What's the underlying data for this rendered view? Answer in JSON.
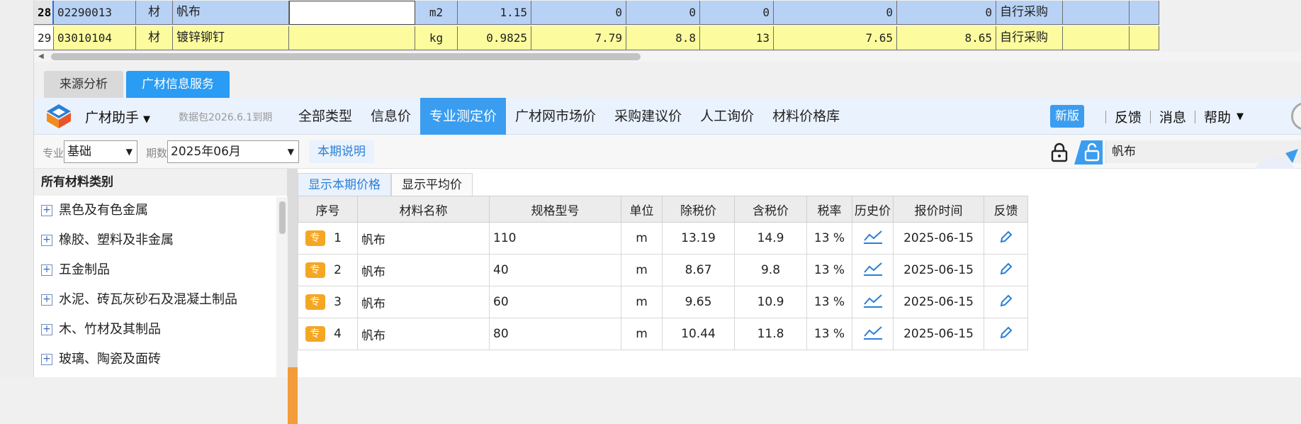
{
  "grid": {
    "rows": [
      {
        "idx": "28",
        "code": "02290013",
        "type": "材",
        "name": "帆布",
        "spec": "",
        "unit": "m2",
        "qty": "1.15",
        "v1": "0",
        "v2": "0",
        "v3": "0",
        "v4": "0",
        "v5": "0",
        "supply": "自行采购"
      },
      {
        "idx": "29",
        "code": "03010104",
        "type": "材",
        "name": "镀锌铆钉",
        "spec": "",
        "unit": "kg",
        "qty": "0.9825",
        "v1": "7.79",
        "v2": "8.8",
        "v3": "13",
        "v4": "7.65",
        "v5": "8.65",
        "supply": "自行采购"
      }
    ]
  },
  "lower_tabs": [
    {
      "label": "来源分析",
      "active": false
    },
    {
      "label": "广材信息服务",
      "active": true
    }
  ],
  "toolbar": {
    "assistant_label": "广材助手",
    "data_package": "数据包2026.6.1到期",
    "nav": [
      {
        "label": "全部类型",
        "active": false
      },
      {
        "label": "信息价",
        "active": false
      },
      {
        "label": "专业测定价",
        "active": true
      },
      {
        "label": "广材网市场价",
        "active": false
      },
      {
        "label": "采购建议价",
        "active": false
      },
      {
        "label": "人工询价",
        "active": false
      },
      {
        "label": "材料价格库",
        "active": false
      }
    ],
    "new_version": "新版",
    "feedback": "反馈",
    "messages": "消息",
    "help": "帮助"
  },
  "filters": {
    "specialty_label": "专业",
    "specialty_value": "基础",
    "period_label": "期数",
    "period_value": "2025年06月",
    "period_note": "本期说明",
    "search_value": "帆布"
  },
  "sidebar": {
    "title": "所有材料类别",
    "items": [
      "黑色及有色金属",
      "橡胶、塑料及非金属",
      "五金制品",
      "水泥、砖瓦灰砂石及混凝土制品",
      "木、竹材及其制品",
      "玻璃、陶瓷及面砖"
    ]
  },
  "price_tabs": [
    {
      "label": "显示本期价格",
      "active": true
    },
    {
      "label": "显示平均价",
      "active": false
    }
  ],
  "price_table": {
    "headers": [
      "序号",
      "材料名称",
      "规格型号",
      "单位",
      "除税价",
      "含税价",
      "税率",
      "历史价",
      "报价时间",
      "反馈"
    ],
    "badge": "专",
    "rows": [
      {
        "no": "1",
        "name": "帆布",
        "spec": "110",
        "unit": "m",
        "ex_tax": "13.19",
        "in_tax": "14.9",
        "rate": "13 %",
        "date": "2025-06-15"
      },
      {
        "no": "2",
        "name": "帆布",
        "spec": "40",
        "unit": "m",
        "ex_tax": "8.67",
        "in_tax": "9.8",
        "rate": "13 %",
        "date": "2025-06-15"
      },
      {
        "no": "3",
        "name": "帆布",
        "spec": "60",
        "unit": "m",
        "ex_tax": "9.65",
        "in_tax": "10.9",
        "rate": "13 %",
        "date": "2025-06-15"
      },
      {
        "no": "4",
        "name": "帆布",
        "spec": "80",
        "unit": "m",
        "ex_tax": "10.44",
        "in_tax": "11.8",
        "rate": "13 %",
        "date": "2025-06-15"
      }
    ]
  },
  "colors": {
    "accent": "#3a9df0",
    "selected_row": "#b8d2f5",
    "highlight_row": "#fcfc9e",
    "badge": "#f5a623"
  }
}
